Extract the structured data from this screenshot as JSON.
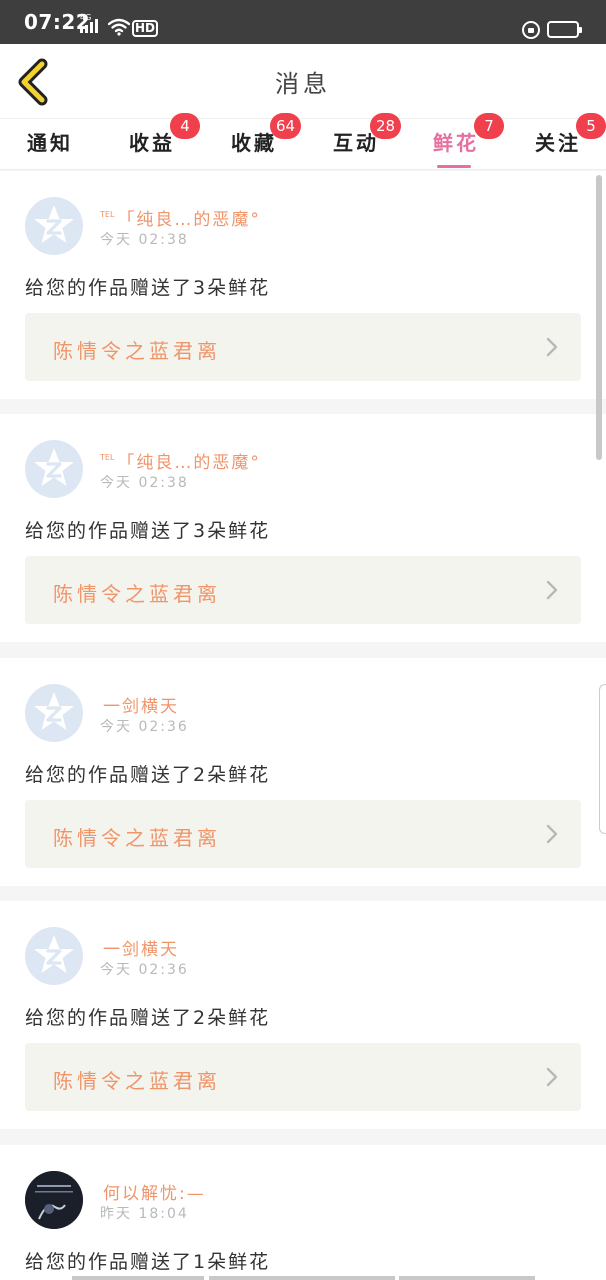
{
  "status_bar": {
    "time": "07:22",
    "network": "4G",
    "hd": "HD"
  },
  "header": {
    "title": "消息",
    "back_icon": "chevron-left-icon"
  },
  "tabs": [
    {
      "label": "通知",
      "badge": "",
      "active": false
    },
    {
      "label": "收益",
      "badge": "4",
      "active": false
    },
    {
      "label": "收藏",
      "badge": "64",
      "active": false
    },
    {
      "label": "互动",
      "badge": "28",
      "active": false
    },
    {
      "label": "鲜花",
      "badge": "7",
      "active": true
    },
    {
      "label": "关注",
      "badge": "5",
      "active": false
    }
  ],
  "feed": [
    {
      "user_prefix": "TEL",
      "user": "「纯良…的恶魔°",
      "time": "今天 02:38",
      "message": "给您的作品赠送了3朵鲜花",
      "work": "陈情令之蓝君离",
      "avatar": "default"
    },
    {
      "user_prefix": "TEL",
      "user": "「纯良…的恶魔°",
      "time": "今天 02:38",
      "message": "给您的作品赠送了3朵鲜花",
      "work": "陈情令之蓝君离",
      "avatar": "default"
    },
    {
      "user_prefix": "",
      "user": "一剑横天",
      "time": "今天 02:36",
      "message": "给您的作品赠送了2朵鲜花",
      "work": "陈情令之蓝君离",
      "avatar": "default"
    },
    {
      "user_prefix": "",
      "user": "一剑横天",
      "time": "今天 02:36",
      "message": "给您的作品赠送了2朵鲜花",
      "work": "陈情令之蓝君离",
      "avatar": "default"
    },
    {
      "user_prefix": "",
      "user": "何以解忧:—",
      "time": "昨天 18:04",
      "message": "给您的作品赠送了1朵鲜花",
      "work": "",
      "avatar": "photo"
    }
  ],
  "colors": {
    "accent": "#e66fa2",
    "badge": "#f0404d",
    "username": "#f0946a",
    "back_icon": "#f2d230"
  }
}
